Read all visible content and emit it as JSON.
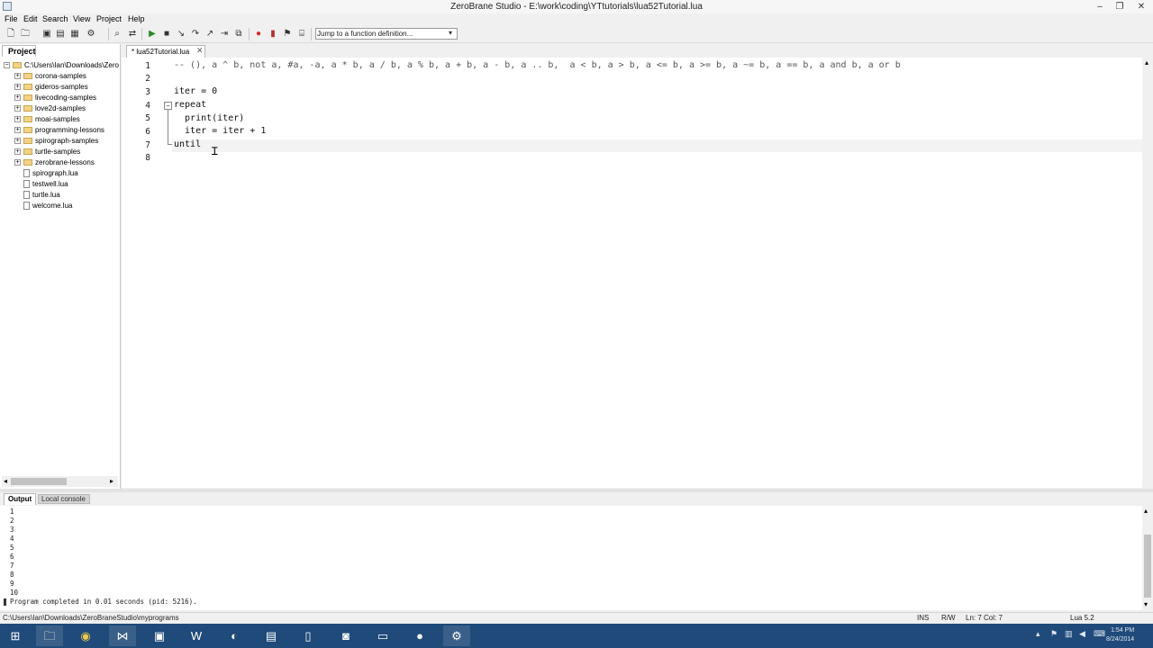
{
  "window": {
    "title": "ZeroBrane Studio - E:\\work\\coding\\YTtutorials\\lua52Tutorial.lua",
    "minimize": "–",
    "maximize": "❐",
    "close": "✕"
  },
  "menu": [
    "File",
    "Edit",
    "Search",
    "View",
    "Project",
    "Help"
  ],
  "toolbar": {
    "icons": [
      "new-file-icon",
      "open-file-icon",
      "save-icon",
      "save-all-icon",
      "project-icon",
      "find-icon",
      "replace-icon",
      "run-icon",
      "stop-icon",
      "step-into-icon",
      "step-over-icon",
      "step-out-icon",
      "run-to-cursor-icon",
      "breakpoint-icon",
      "bookmark-icon",
      "toggle-icon",
      "watch-icon"
    ],
    "function_dropdown": "Jump to a function definition..."
  },
  "project": {
    "tab_label": "Project",
    "root": "C:\\Users\\Ian\\Downloads\\Zero",
    "folders": [
      "corona-samples",
      "gideros-samples",
      "livecoding-samples",
      "love2d-samples",
      "moai-samples",
      "programming-lessons",
      "spirograph-samples",
      "turtle-samples",
      "zerobrane-lessons"
    ],
    "files": [
      "spirograph.lua",
      "testwell.lua",
      "turtle.lua",
      "welcome.lua"
    ]
  },
  "editor": {
    "tab_label": "* lua52Tutorial.lua",
    "tab_close": "✕",
    "line_numbers": [
      "1",
      "2",
      "3",
      "4",
      "5",
      "6",
      "7",
      "8"
    ],
    "lines": [
      "-- (), a ^ b, not a, #a, -a, a * b, a / b, a % b, a + b, a - b, a .. b,  a < b, a > b, a <= b, a >= b, a ~= b, a == b, a and b, a or b",
      "",
      "iter = 0",
      "repeat",
      "  print(iter)",
      "  iter = iter + 1",
      "until",
      ""
    ],
    "fold_marker": "−"
  },
  "output": {
    "tab_label": "Output",
    "console_tab_label": "Local console",
    "lines": [
      "1",
      "2",
      "3",
      "4",
      "5",
      "6",
      "7",
      "8",
      "9",
      "10"
    ],
    "completion": "Program completed in 0.01 seconds (pid: 5216)."
  },
  "status": {
    "path": "C:\\Users\\Ian\\Downloads\\ZeroBraneStudio\\myprograms",
    "mode": "INS",
    "rw": "R/W",
    "position": "Ln: 7 Col: 7",
    "language": "Lua 5.2"
  },
  "taskbar": {
    "clock_time": "1:54 PM",
    "clock_date": "8/24/2014"
  },
  "colors": {
    "taskbar": "#1f4a7a",
    "folder": "#f1d287",
    "breakpoint": "#d42a2a"
  }
}
